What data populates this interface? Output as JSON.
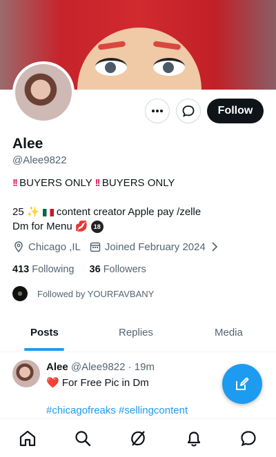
{
  "profile": {
    "name": "Alee",
    "handle": "@Alee9822",
    "bio_line1_text1": "BUYERS ONLY",
    "bio_line1_text2": "BUYERS ONLY",
    "bio_line2_prefix": "25",
    "bio_line2_text": "content creator Apple pay /zelle",
    "bio_line3_text": "Dm for Menu",
    "age_badge": "18",
    "location": "Chicago ,IL",
    "joined": "Joined February 2024",
    "following_count": "413",
    "following_label": "Following",
    "followers_count": "36",
    "followers_label": "Followers",
    "followed_by": "Followed by YOURFAVBANY"
  },
  "actions": {
    "follow_label": "Follow"
  },
  "tabs": [
    {
      "label": "Posts",
      "active": true
    },
    {
      "label": "Replies",
      "active": false
    },
    {
      "label": "Media",
      "active": false
    }
  ],
  "tweet": {
    "author": "Alee",
    "handle_time": "@Alee9822 · 19m",
    "text": "For Free Pic in Dm",
    "hashtags": "#chicagofreaks #sellingcontent"
  },
  "icons": {
    "more": "more-horizontal-icon",
    "message": "message-bubble-icon",
    "location": "location-pin-icon",
    "calendar": "calendar-icon",
    "compose": "compose-icon",
    "nav": [
      "home-icon",
      "search-icon",
      "grok-icon",
      "notifications-icon",
      "messages-icon"
    ]
  },
  "colors": {
    "accent": "#1d9bf0",
    "text": "#0f1419",
    "secondary": "#536471"
  }
}
